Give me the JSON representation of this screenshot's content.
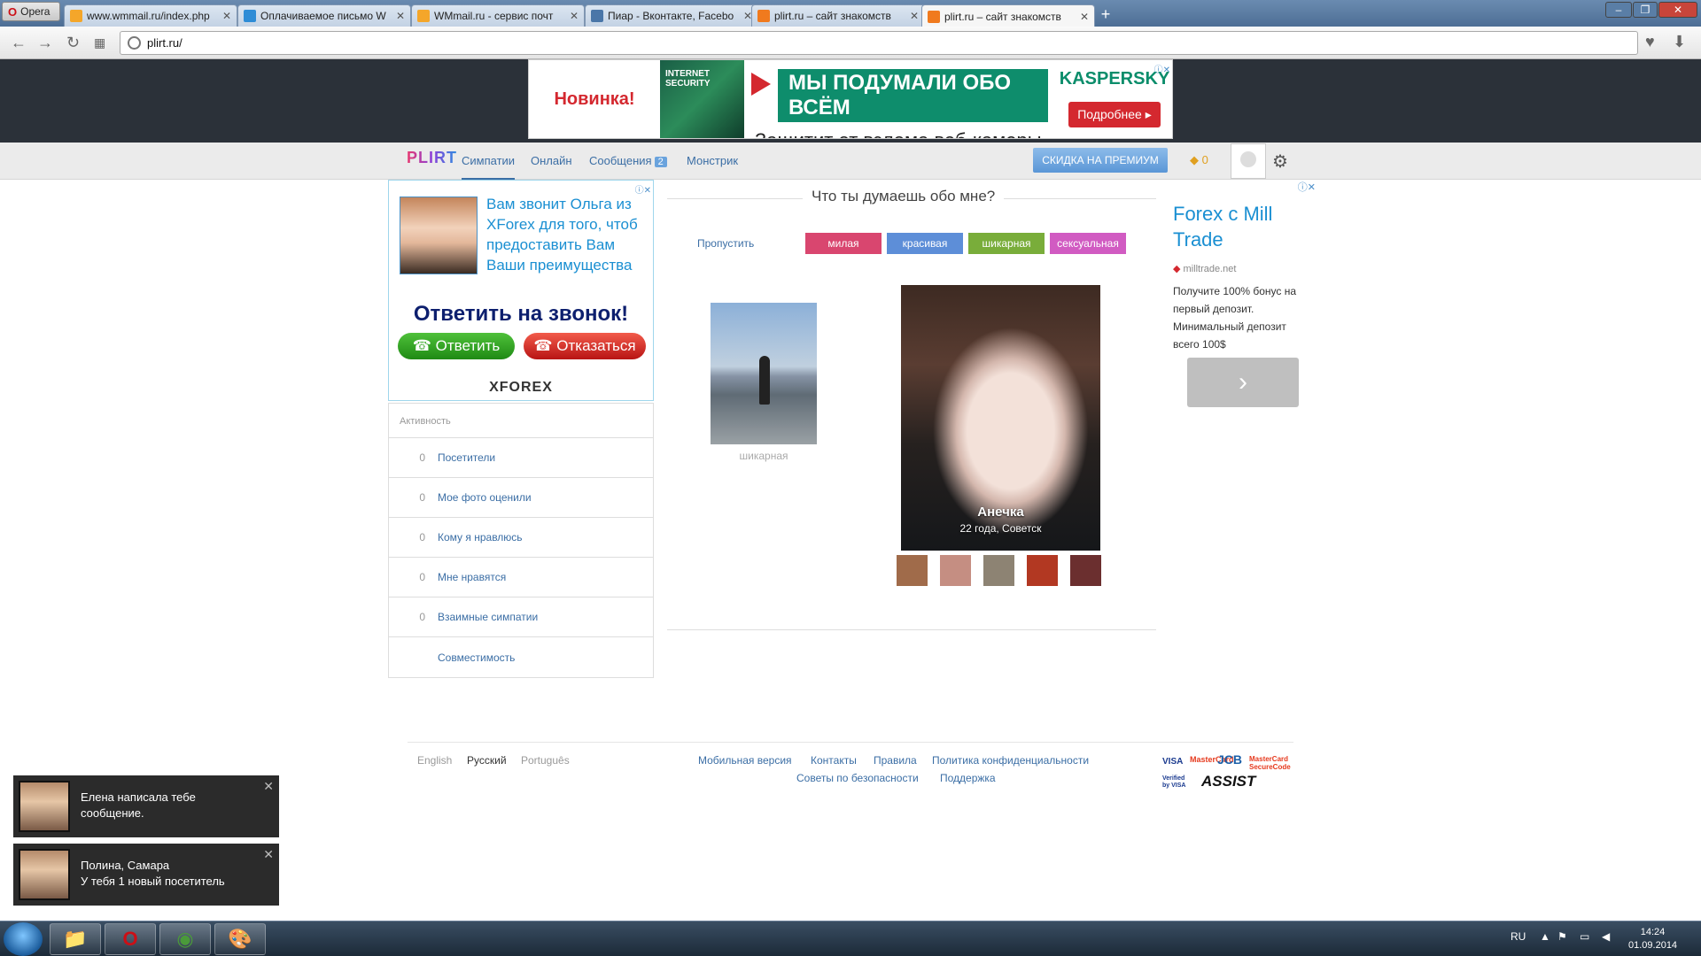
{
  "browser": {
    "app_label": "Opera",
    "tabs": [
      {
        "title": "www.wmmail.ru/index.php",
        "color": "#f4a62a"
      },
      {
        "title": "Оплачиваемое письмо W",
        "color": "#2e8cd6"
      },
      {
        "title": "WMmail.ru - сервис почт",
        "color": "#f4a62a"
      },
      {
        "title": "Пиар - Вконтакте, Facebo",
        "color": "#4a76a8"
      },
      {
        "title": "plirt.ru – сайт знакомств",
        "color": "#f07a1e"
      },
      {
        "title": "plirt.ru – сайт знакомств",
        "color": "#f07a1e"
      }
    ],
    "url": "plirt.ru/"
  },
  "ad_banner": {
    "badge": "Новинка!",
    "box_text": "INTERNET SECURITY",
    "headline": "МЫ ПОДУМАЛИ ОБО ВСЁМ",
    "subline": "Защитит от взлома веб-камеры",
    "brand": "KASPERSKY",
    "button": "Подробнее ▸"
  },
  "site_nav": {
    "logo": "PLIRT",
    "links": [
      "Симпатии",
      "Онлайн",
      "Сообщения",
      "Монстрик"
    ],
    "messages_badge": "2",
    "premium": "СКИДКА НА ПРЕМИУМ",
    "coins": "0"
  },
  "left_ad": {
    "text": "Вам звонит Ольга из XForex для того, чтоб предоставить Вам Ваши преимущества",
    "call": "Ответить на звонок!",
    "answer": "Ответить",
    "decline": "Отказаться",
    "brand": "XFOREX"
  },
  "activity": {
    "title": "Активность",
    "items": [
      {
        "count": "0",
        "label": "Посетители"
      },
      {
        "count": "0",
        "label": "Мое фото оценили"
      },
      {
        "count": "0",
        "label": "Кому я нравлюсь"
      },
      {
        "count": "0",
        "label": "Мне нравятся"
      },
      {
        "count": "0",
        "label": "Взаимные симпатии"
      },
      {
        "count": "",
        "label": "Совместимость"
      }
    ]
  },
  "rating": {
    "question": "Что ты думаешь обо мне?",
    "skip": "Пропустить",
    "options": [
      {
        "label": "милая",
        "color": "#d9466f"
      },
      {
        "label": "красивая",
        "color": "#5d8ed8"
      },
      {
        "label": "шикарная",
        "color": "#79ad3a"
      },
      {
        "label": "сексуальная",
        "color": "#d15bc2"
      }
    ],
    "previous_caption": "шикарная",
    "profile_name": "Анечка",
    "profile_info": "22 года, Советск",
    "thumb_colors": [
      "#a06b4a",
      "#c58e82",
      "#8d8373",
      "#b23822",
      "#6b2f2f"
    ]
  },
  "right_ad": {
    "title": "Forex с Mill Trade",
    "domain": "milltrade.net",
    "text": "Получите 100% бонус на первый депозит. Минимальный депозит всего 100$",
    "arrow": "›"
  },
  "footer": {
    "languages": [
      "English",
      "Русский",
      "Português"
    ],
    "links_row1": [
      "Мобильная версия",
      "Контакты",
      "Правила",
      "Политика конфиденциальности"
    ],
    "links_row2": [
      "Советы по безопасности",
      "Поддержка"
    ],
    "payments": [
      "VISA",
      "MasterCard",
      "JCB",
      "MasterCard SecureCode",
      "Verified by VISA",
      "ASSIST"
    ]
  },
  "notifications": [
    {
      "text": "Елена написала тебе сообщение."
    },
    {
      "text": "Полина, Самара\nУ тебя 1 новый посетитель"
    }
  ],
  "taskbar": {
    "lang": "RU",
    "time": "14:24",
    "date": "01.09.2014"
  }
}
